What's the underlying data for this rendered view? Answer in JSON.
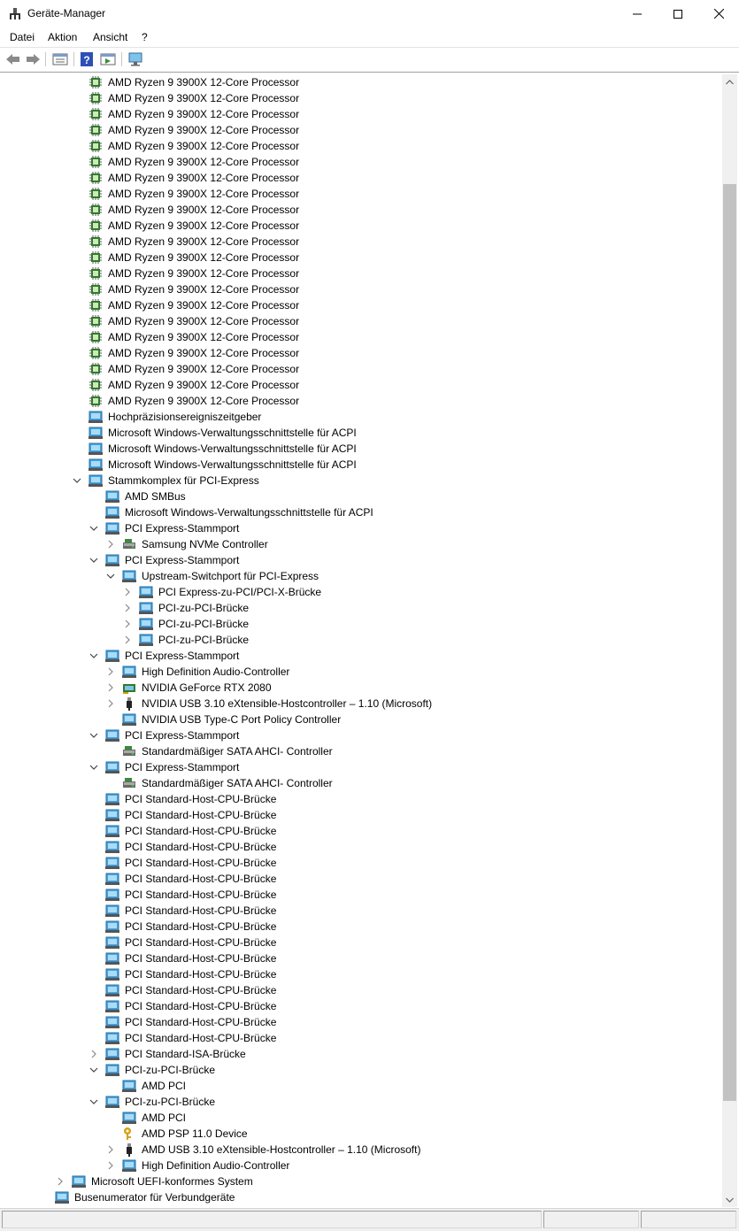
{
  "window": {
    "title": "Geräte-Manager"
  },
  "menu": [
    "Datei",
    "Aktion",
    "Ansicht",
    "?"
  ],
  "toolbar": [
    "back-icon",
    "forward-icon",
    "properties-icon",
    "help-icon",
    "run-icon",
    "monitor-icon"
  ],
  "tree": [
    {
      "label": "AMD Ryzen 9 3900X 12-Core Processor",
      "level": 3,
      "icon": "cpu",
      "exp": ""
    },
    {
      "label": "AMD Ryzen 9 3900X 12-Core Processor",
      "level": 3,
      "icon": "cpu",
      "exp": ""
    },
    {
      "label": "AMD Ryzen 9 3900X 12-Core Processor",
      "level": 3,
      "icon": "cpu",
      "exp": ""
    },
    {
      "label": "AMD Ryzen 9 3900X 12-Core Processor",
      "level": 3,
      "icon": "cpu",
      "exp": ""
    },
    {
      "label": "AMD Ryzen 9 3900X 12-Core Processor",
      "level": 3,
      "icon": "cpu",
      "exp": ""
    },
    {
      "label": "AMD Ryzen 9 3900X 12-Core Processor",
      "level": 3,
      "icon": "cpu",
      "exp": ""
    },
    {
      "label": "AMD Ryzen 9 3900X 12-Core Processor",
      "level": 3,
      "icon": "cpu",
      "exp": ""
    },
    {
      "label": "AMD Ryzen 9 3900X 12-Core Processor",
      "level": 3,
      "icon": "cpu",
      "exp": ""
    },
    {
      "label": "AMD Ryzen 9 3900X 12-Core Processor",
      "level": 3,
      "icon": "cpu",
      "exp": ""
    },
    {
      "label": "AMD Ryzen 9 3900X 12-Core Processor",
      "level": 3,
      "icon": "cpu",
      "exp": ""
    },
    {
      "label": "AMD Ryzen 9 3900X 12-Core Processor",
      "level": 3,
      "icon": "cpu",
      "exp": ""
    },
    {
      "label": "AMD Ryzen 9 3900X 12-Core Processor",
      "level": 3,
      "icon": "cpu",
      "exp": ""
    },
    {
      "label": "AMD Ryzen 9 3900X 12-Core Processor",
      "level": 3,
      "icon": "cpu",
      "exp": ""
    },
    {
      "label": "AMD Ryzen 9 3900X 12-Core Processor",
      "level": 3,
      "icon": "cpu",
      "exp": ""
    },
    {
      "label": "AMD Ryzen 9 3900X 12-Core Processor",
      "level": 3,
      "icon": "cpu",
      "exp": ""
    },
    {
      "label": "AMD Ryzen 9 3900X 12-Core Processor",
      "level": 3,
      "icon": "cpu",
      "exp": ""
    },
    {
      "label": "AMD Ryzen 9 3900X 12-Core Processor",
      "level": 3,
      "icon": "cpu",
      "exp": ""
    },
    {
      "label": "AMD Ryzen 9 3900X 12-Core Processor",
      "level": 3,
      "icon": "cpu",
      "exp": ""
    },
    {
      "label": "AMD Ryzen 9 3900X 12-Core Processor",
      "level": 3,
      "icon": "cpu",
      "exp": ""
    },
    {
      "label": "AMD Ryzen 9 3900X 12-Core Processor",
      "level": 3,
      "icon": "cpu",
      "exp": ""
    },
    {
      "label": "AMD Ryzen 9 3900X 12-Core Processor",
      "level": 3,
      "icon": "cpu",
      "exp": ""
    },
    {
      "label": "Hochpräzisionsereigniszeitgeber",
      "level": 3,
      "icon": "dev",
      "exp": ""
    },
    {
      "label": "Microsoft Windows-Verwaltungsschnittstelle für ACPI",
      "level": 3,
      "icon": "dev",
      "exp": ""
    },
    {
      "label": "Microsoft Windows-Verwaltungsschnittstelle für ACPI",
      "level": 3,
      "icon": "dev",
      "exp": ""
    },
    {
      "label": "Microsoft Windows-Verwaltungsschnittstelle für ACPI",
      "level": 3,
      "icon": "dev",
      "exp": ""
    },
    {
      "label": "Stammkomplex für PCI-Express",
      "level": 3,
      "icon": "dev",
      "exp": "open"
    },
    {
      "label": "AMD SMBus",
      "level": 4,
      "icon": "dev",
      "exp": ""
    },
    {
      "label": "Microsoft Windows-Verwaltungsschnittstelle für ACPI",
      "level": 4,
      "icon": "dev",
      "exp": ""
    },
    {
      "label": "PCI Express-Stammport",
      "level": 4,
      "icon": "dev",
      "exp": "open"
    },
    {
      "label": "Samsung NVMe Controller",
      "level": 5,
      "icon": "storage",
      "exp": "closed"
    },
    {
      "label": "PCI Express-Stammport",
      "level": 4,
      "icon": "dev",
      "exp": "open"
    },
    {
      "label": "Upstream-Switchport für PCI-Express",
      "level": 5,
      "icon": "dev",
      "exp": "open"
    },
    {
      "label": "PCI Express-zu-PCI/PCI-X-Brücke",
      "level": 6,
      "icon": "dev",
      "exp": "closed"
    },
    {
      "label": "PCI-zu-PCI-Brücke",
      "level": 6,
      "icon": "dev",
      "exp": "closed"
    },
    {
      "label": "PCI-zu-PCI-Brücke",
      "level": 6,
      "icon": "dev",
      "exp": "closed"
    },
    {
      "label": "PCI-zu-PCI-Brücke",
      "level": 6,
      "icon": "dev",
      "exp": "closed"
    },
    {
      "label": "PCI Express-Stammport",
      "level": 4,
      "icon": "dev",
      "exp": "open"
    },
    {
      "label": "High Definition Audio-Controller",
      "level": 5,
      "icon": "dev",
      "exp": "closed"
    },
    {
      "label": "NVIDIA GeForce RTX 2080",
      "level": 5,
      "icon": "gpu",
      "exp": "closed"
    },
    {
      "label": "NVIDIA USB 3.10 eXtensible-Hostcontroller – 1.10 (Microsoft)",
      "level": 5,
      "icon": "usb",
      "exp": "closed"
    },
    {
      "label": "NVIDIA USB Type-C Port Policy Controller",
      "level": 5,
      "icon": "dev",
      "exp": ""
    },
    {
      "label": "PCI Express-Stammport",
      "level": 4,
      "icon": "dev",
      "exp": "open"
    },
    {
      "label": "Standardmäßiger SATA AHCI- Controller",
      "level": 5,
      "icon": "storage",
      "exp": ""
    },
    {
      "label": "PCI Express-Stammport",
      "level": 4,
      "icon": "dev",
      "exp": "open"
    },
    {
      "label": "Standardmäßiger SATA AHCI- Controller",
      "level": 5,
      "icon": "storage",
      "exp": ""
    },
    {
      "label": "PCI Standard-Host-CPU-Brücke",
      "level": 4,
      "icon": "dev",
      "exp": ""
    },
    {
      "label": "PCI Standard-Host-CPU-Brücke",
      "level": 4,
      "icon": "dev",
      "exp": ""
    },
    {
      "label": "PCI Standard-Host-CPU-Brücke",
      "level": 4,
      "icon": "dev",
      "exp": ""
    },
    {
      "label": "PCI Standard-Host-CPU-Brücke",
      "level": 4,
      "icon": "dev",
      "exp": ""
    },
    {
      "label": "PCI Standard-Host-CPU-Brücke",
      "level": 4,
      "icon": "dev",
      "exp": ""
    },
    {
      "label": "PCI Standard-Host-CPU-Brücke",
      "level": 4,
      "icon": "dev",
      "exp": ""
    },
    {
      "label": "PCI Standard-Host-CPU-Brücke",
      "level": 4,
      "icon": "dev",
      "exp": ""
    },
    {
      "label": "PCI Standard-Host-CPU-Brücke",
      "level": 4,
      "icon": "dev",
      "exp": ""
    },
    {
      "label": "PCI Standard-Host-CPU-Brücke",
      "level": 4,
      "icon": "dev",
      "exp": ""
    },
    {
      "label": "PCI Standard-Host-CPU-Brücke",
      "level": 4,
      "icon": "dev",
      "exp": ""
    },
    {
      "label": "PCI Standard-Host-CPU-Brücke",
      "level": 4,
      "icon": "dev",
      "exp": ""
    },
    {
      "label": "PCI Standard-Host-CPU-Brücke",
      "level": 4,
      "icon": "dev",
      "exp": ""
    },
    {
      "label": "PCI Standard-Host-CPU-Brücke",
      "level": 4,
      "icon": "dev",
      "exp": ""
    },
    {
      "label": "PCI Standard-Host-CPU-Brücke",
      "level": 4,
      "icon": "dev",
      "exp": ""
    },
    {
      "label": "PCI Standard-Host-CPU-Brücke",
      "level": 4,
      "icon": "dev",
      "exp": ""
    },
    {
      "label": "PCI Standard-Host-CPU-Brücke",
      "level": 4,
      "icon": "dev",
      "exp": ""
    },
    {
      "label": "PCI Standard-ISA-Brücke",
      "level": 4,
      "icon": "dev",
      "exp": "closed"
    },
    {
      "label": "PCI-zu-PCI-Brücke",
      "level": 4,
      "icon": "dev",
      "exp": "open"
    },
    {
      "label": "AMD PCI",
      "level": 5,
      "icon": "dev",
      "exp": ""
    },
    {
      "label": "PCI-zu-PCI-Brücke",
      "level": 4,
      "icon": "dev",
      "exp": "open"
    },
    {
      "label": "AMD PCI",
      "level": 5,
      "icon": "dev",
      "exp": ""
    },
    {
      "label": "AMD PSP 11.0 Device",
      "level": 5,
      "icon": "key",
      "exp": ""
    },
    {
      "label": "AMD USB 3.10 eXtensible-Hostcontroller – 1.10 (Microsoft)",
      "level": 5,
      "icon": "usb",
      "exp": "closed"
    },
    {
      "label": "High Definition Audio-Controller",
      "level": 5,
      "icon": "dev",
      "exp": "closed"
    },
    {
      "label": "Microsoft UEFI-konformes System",
      "level": 2,
      "icon": "dev",
      "exp": "closed"
    },
    {
      "label": "Busenumerator für Verbundgeräte",
      "level": 1,
      "icon": "dev",
      "exp": ""
    }
  ]
}
